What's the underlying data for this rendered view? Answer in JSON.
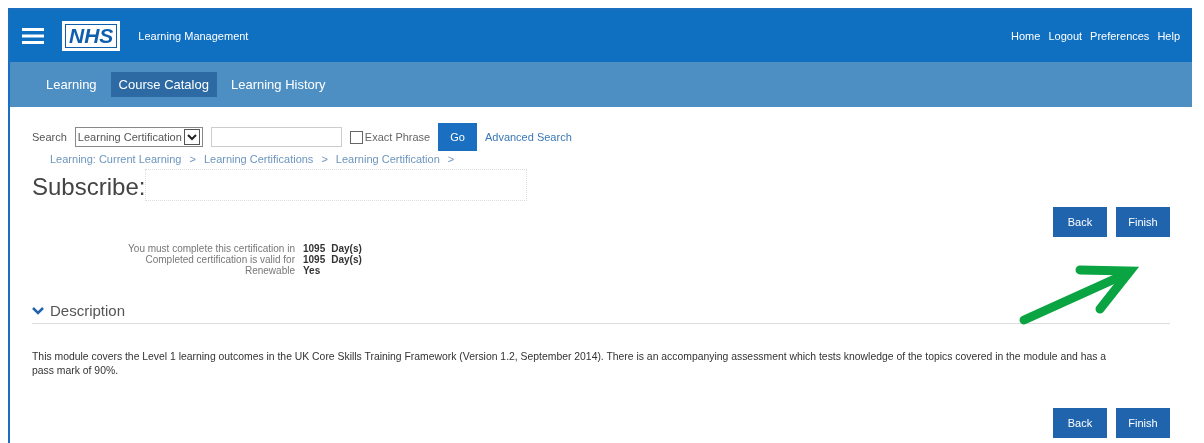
{
  "header": {
    "logo": "NHS",
    "app_title": "Learning Management",
    "links": [
      "Home",
      "Logout",
      "Preferences",
      "Help"
    ]
  },
  "tabs": [
    {
      "label": "Learning",
      "selected": false
    },
    {
      "label": "Course Catalog",
      "selected": true
    },
    {
      "label": "Learning History",
      "selected": false
    }
  ],
  "search": {
    "label": "Search",
    "scope": "Learning Certification",
    "exact_phrase": {
      "label": "Exact Phrase",
      "checked": false
    },
    "go": "Go",
    "advanced": "Advanced Search"
  },
  "breadcrumbs": [
    "Learning: Current Learning",
    "Learning Certifications",
    "Learning Certification"
  ],
  "breadcrumb_separator": ">",
  "page_title": "Subscribe:",
  "actions_top": [
    "Back",
    "Finish"
  ],
  "details": [
    {
      "label": "You must complete this certification in",
      "value": "1095",
      "unit": "Day(s)"
    },
    {
      "label": "Completed certification is valid for",
      "value": "1095",
      "unit": "Day(s)"
    },
    {
      "label": "Renewable",
      "value": "Yes"
    }
  ],
  "description": {
    "title": "Description",
    "expanded": true,
    "text": "This module covers the Level 1 learning outcomes in the UK Core Skills Training Framework (Version 1.2, September 2014). There is an accompanying assessment which tests knowledge of the topics covered in the module and has a pass mark of 90%."
  },
  "actions_bottom": [
    "Back",
    "Finish"
  ]
}
